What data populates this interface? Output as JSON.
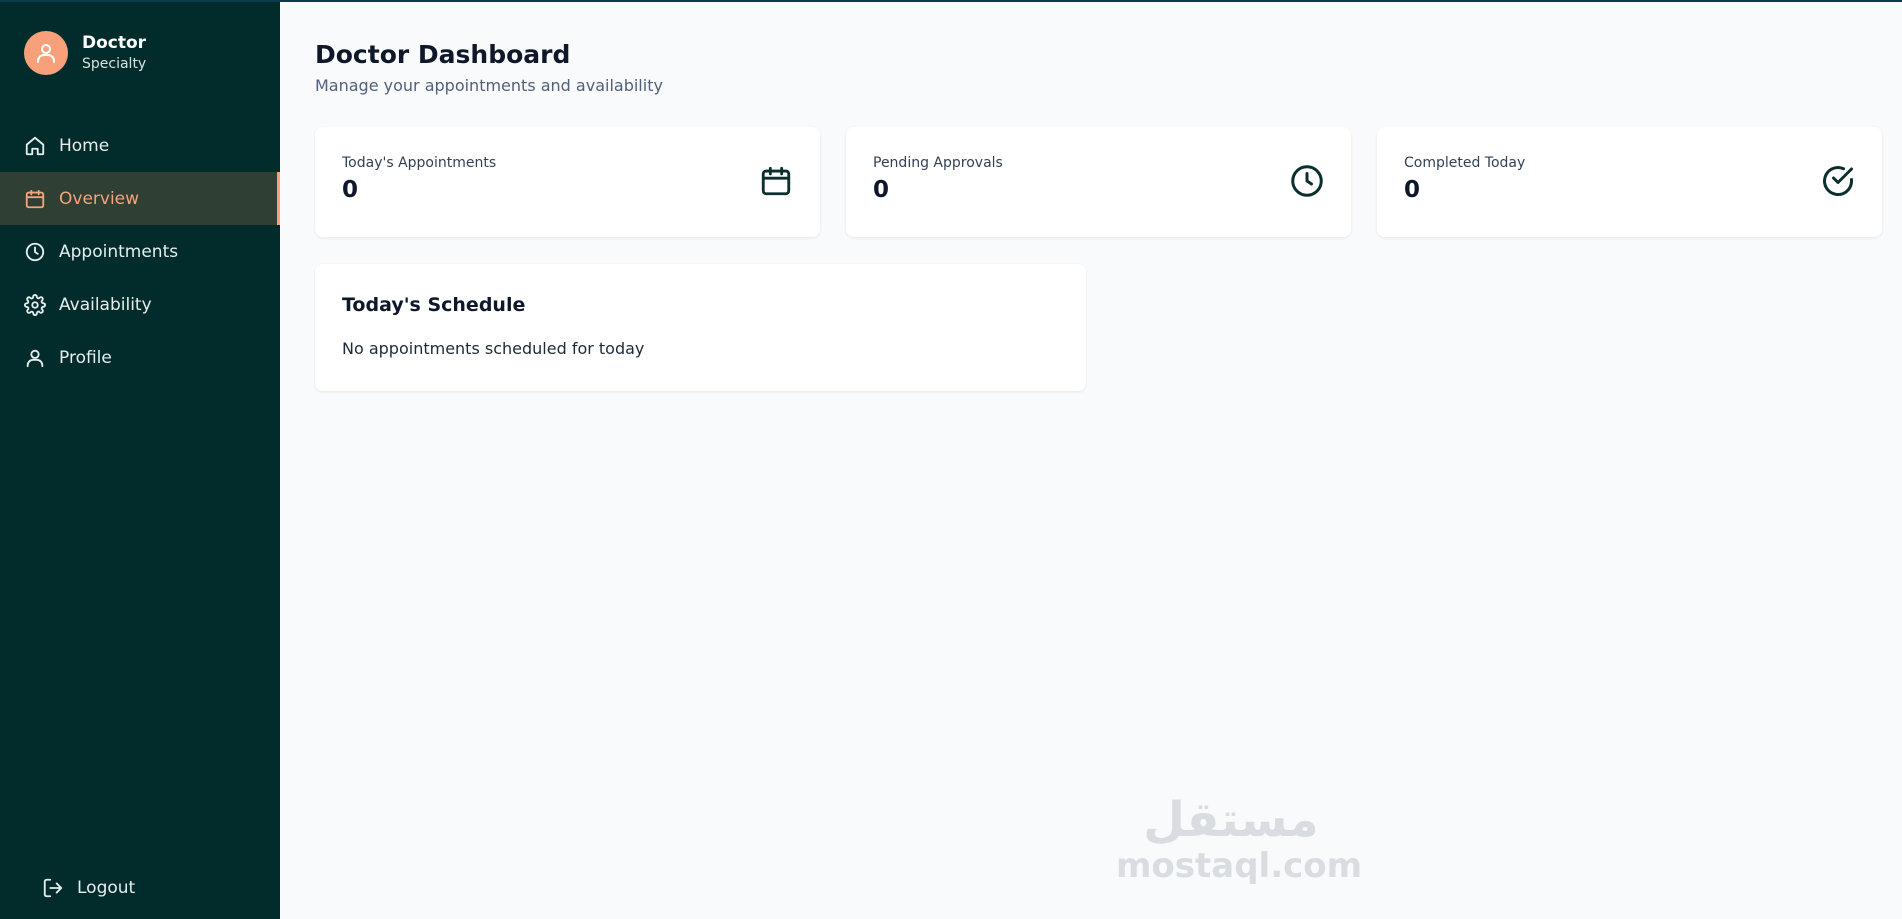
{
  "profile": {
    "name": "Doctor",
    "specialty": "Specialty"
  },
  "sidebar": {
    "items": [
      {
        "label": "Home",
        "icon": "home-icon"
      },
      {
        "label": "Overview",
        "icon": "calendar-icon",
        "active": true
      },
      {
        "label": "Appointments",
        "icon": "clock-icon"
      },
      {
        "label": "Availability",
        "icon": "gear-icon"
      },
      {
        "label": "Profile",
        "icon": "user-icon"
      }
    ],
    "logout_label": "Logout"
  },
  "header": {
    "title": "Doctor Dashboard",
    "subtitle": "Manage your appointments and availability"
  },
  "stats": [
    {
      "label": "Today's Appointments",
      "value": "0",
      "icon": "calendar-icon"
    },
    {
      "label": "Pending Approvals",
      "value": "0",
      "icon": "clock-icon"
    },
    {
      "label": "Completed Today",
      "value": "0",
      "icon": "check-circle-icon"
    }
  ],
  "schedule": {
    "title": "Today's Schedule",
    "empty_message": "No appointments scheduled for today"
  },
  "watermark": {
    "arabic": "مستقل",
    "latin": "mostaql.com"
  },
  "colors": {
    "sidebar_bg": "#022c2b",
    "accent": "#f6a27c",
    "active_bg": "#2f3f34",
    "main_bg": "#f8fafc"
  }
}
